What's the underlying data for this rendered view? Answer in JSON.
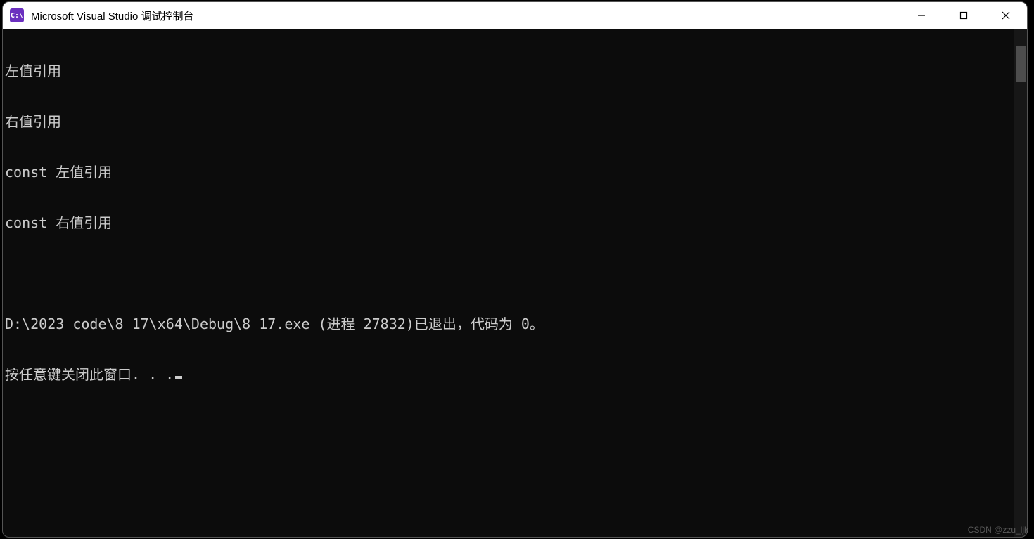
{
  "titlebar": {
    "icon_text": "C:\\",
    "title": "Microsoft Visual Studio 调试控制台"
  },
  "console": {
    "lines": [
      "左值引用",
      "右值引用",
      "const 左值引用",
      "const 右值引用",
      "",
      "D:\\2023_code\\8_17\\x64\\Debug\\8_17.exe (进程 27832)已退出，代码为 0。"
    ],
    "prompt_line": "按任意键关闭此窗口. . ."
  },
  "watermark": "CSDN @zzu_ljk"
}
